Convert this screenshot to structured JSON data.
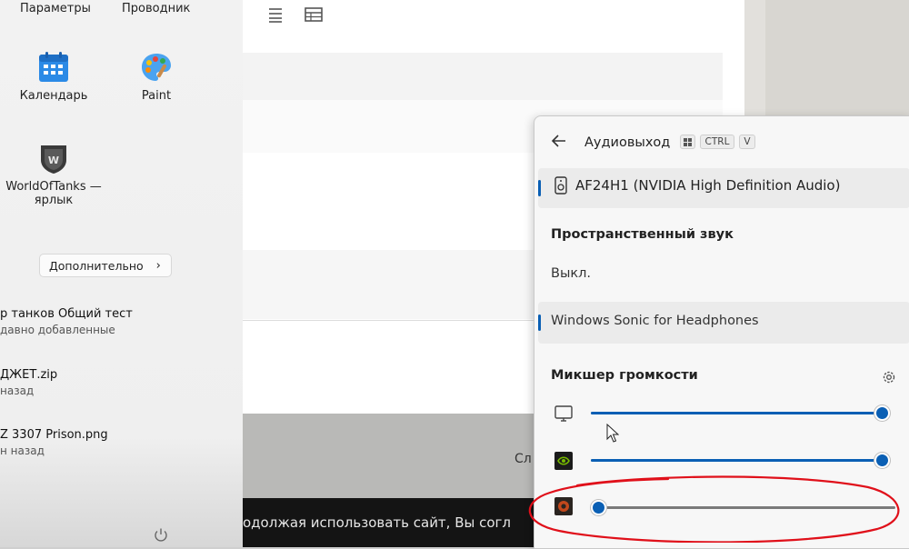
{
  "start_menu": {
    "pinned_top": [
      {
        "label": "Параметры"
      },
      {
        "label": "Проводник"
      }
    ],
    "pinned": [
      {
        "label": "Календарь",
        "icon": "calendar-icon"
      },
      {
        "label": "Paint",
        "icon": "paint-palette-icon"
      },
      {
        "label_line1": "WorldOfTanks —",
        "label_line2": "ярлык",
        "icon": "world-of-tanks-icon"
      }
    ],
    "more_button": "Дополнительно",
    "recommended": [
      {
        "title": "р танков Общий тест",
        "sub": "давно добавленные"
      },
      {
        "title": "ДЖЕТ.zip",
        "sub": "назад"
      },
      {
        "title": "Z 3307 Prison.png",
        "sub": "н назад"
      }
    ],
    "power_icon": "power-icon"
  },
  "browser": {
    "toolbar_icons": [
      "list-icon",
      "table-icon"
    ],
    "cookie_text": "одолжая использовать сайт, Вы согл",
    "partial_text": "Сл"
  },
  "audio_flyout": {
    "title": "Аудиовыход",
    "shortcut_keys": [
      "⊞",
      "CTRL",
      "V"
    ],
    "device": "AF24H1 (NVIDIA High Definition Audio)",
    "spatial_heading": "Пространственный звук",
    "spatial_option_off": "Выкл.",
    "spatial_option_selected": "Windows Sonic for Headphones",
    "mixer_heading": "Микшер громкости",
    "mixer": [
      {
        "icon": "monitor-icon",
        "level": 1.0
      },
      {
        "icon": "nvidia-app-icon",
        "level": 1.0
      },
      {
        "icon": "world-of-tanks-app-icon",
        "level": 0.0
      }
    ],
    "accent_color": "#0a5fb4",
    "annotation_color": "#e0101a"
  }
}
